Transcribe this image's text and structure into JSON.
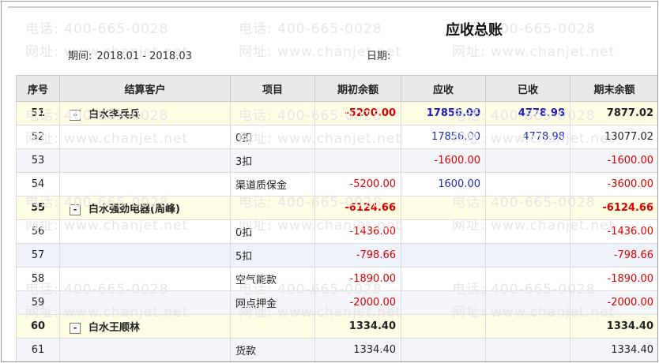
{
  "report": {
    "title": "应收总账",
    "period_label": "期间:",
    "period_value": "2018.01 - 2018.03",
    "date_label": "日期:"
  },
  "table": {
    "headers": [
      "序号",
      "结算客户",
      "项目",
      "期初余额",
      "应收",
      "已收",
      "期末余额"
    ],
    "rows": [
      {
        "no": "51",
        "customer": "白水李兵兵",
        "item": "",
        "opening": "-5200.00",
        "receivable": "17856.00",
        "received": "4778.98",
        "closing": "7877.02",
        "group": true
      },
      {
        "no": "52",
        "customer": "",
        "item": "0扣",
        "opening": "",
        "receivable": "17856.00",
        "received": "4778.98",
        "closing": "13077.02",
        "group": false
      },
      {
        "no": "53",
        "customer": "",
        "item": "3扣",
        "opening": "",
        "receivable": "-1600.00",
        "received": "",
        "closing": "-1600.00",
        "group": false
      },
      {
        "no": "54",
        "customer": "",
        "item": "渠道质保金",
        "opening": "-5200.00",
        "receivable": "1600.00",
        "received": "",
        "closing": "-3600.00",
        "group": false
      },
      {
        "no": "55",
        "customer": "白水强劲电器(周峰)",
        "item": "",
        "opening": "-6124.66",
        "receivable": "",
        "received": "",
        "closing": "-6124.66",
        "group": true
      },
      {
        "no": "56",
        "customer": "",
        "item": "0扣",
        "opening": "-1436.00",
        "receivable": "",
        "received": "",
        "closing": "-1436.00",
        "group": false
      },
      {
        "no": "57",
        "customer": "",
        "item": "5扣",
        "opening": "-798.66",
        "receivable": "",
        "received": "",
        "closing": "-798.66",
        "group": false,
        "highlight": true
      },
      {
        "no": "58",
        "customer": "",
        "item": "空气能款",
        "opening": "-1890.00",
        "receivable": "",
        "received": "",
        "closing": "-1890.00",
        "group": false
      },
      {
        "no": "59",
        "customer": "",
        "item": "网点押金",
        "opening": "-2000.00",
        "receivable": "",
        "received": "",
        "closing": "-2000.00",
        "group": false
      },
      {
        "no": "60",
        "customer": "白水王顺林",
        "item": "",
        "opening": "1334.40",
        "receivable": "",
        "received": "",
        "closing": "1334.40",
        "group": true
      },
      {
        "no": "61",
        "customer": "",
        "item": "货款",
        "opening": "1334.40",
        "receivable": "",
        "received": "",
        "closing": "1334.40",
        "group": false
      }
    ]
  },
  "toggle_symbol": "-",
  "watermark": {
    "phone": "电话: 400-665-0028",
    "site": "网址: www.chanjet.net"
  },
  "colors": {
    "negative": "#e00000",
    "receivable_blue": "#1f2fb5",
    "group_row_bg": "#fffde3",
    "header_bg": "#e9e9e9"
  }
}
